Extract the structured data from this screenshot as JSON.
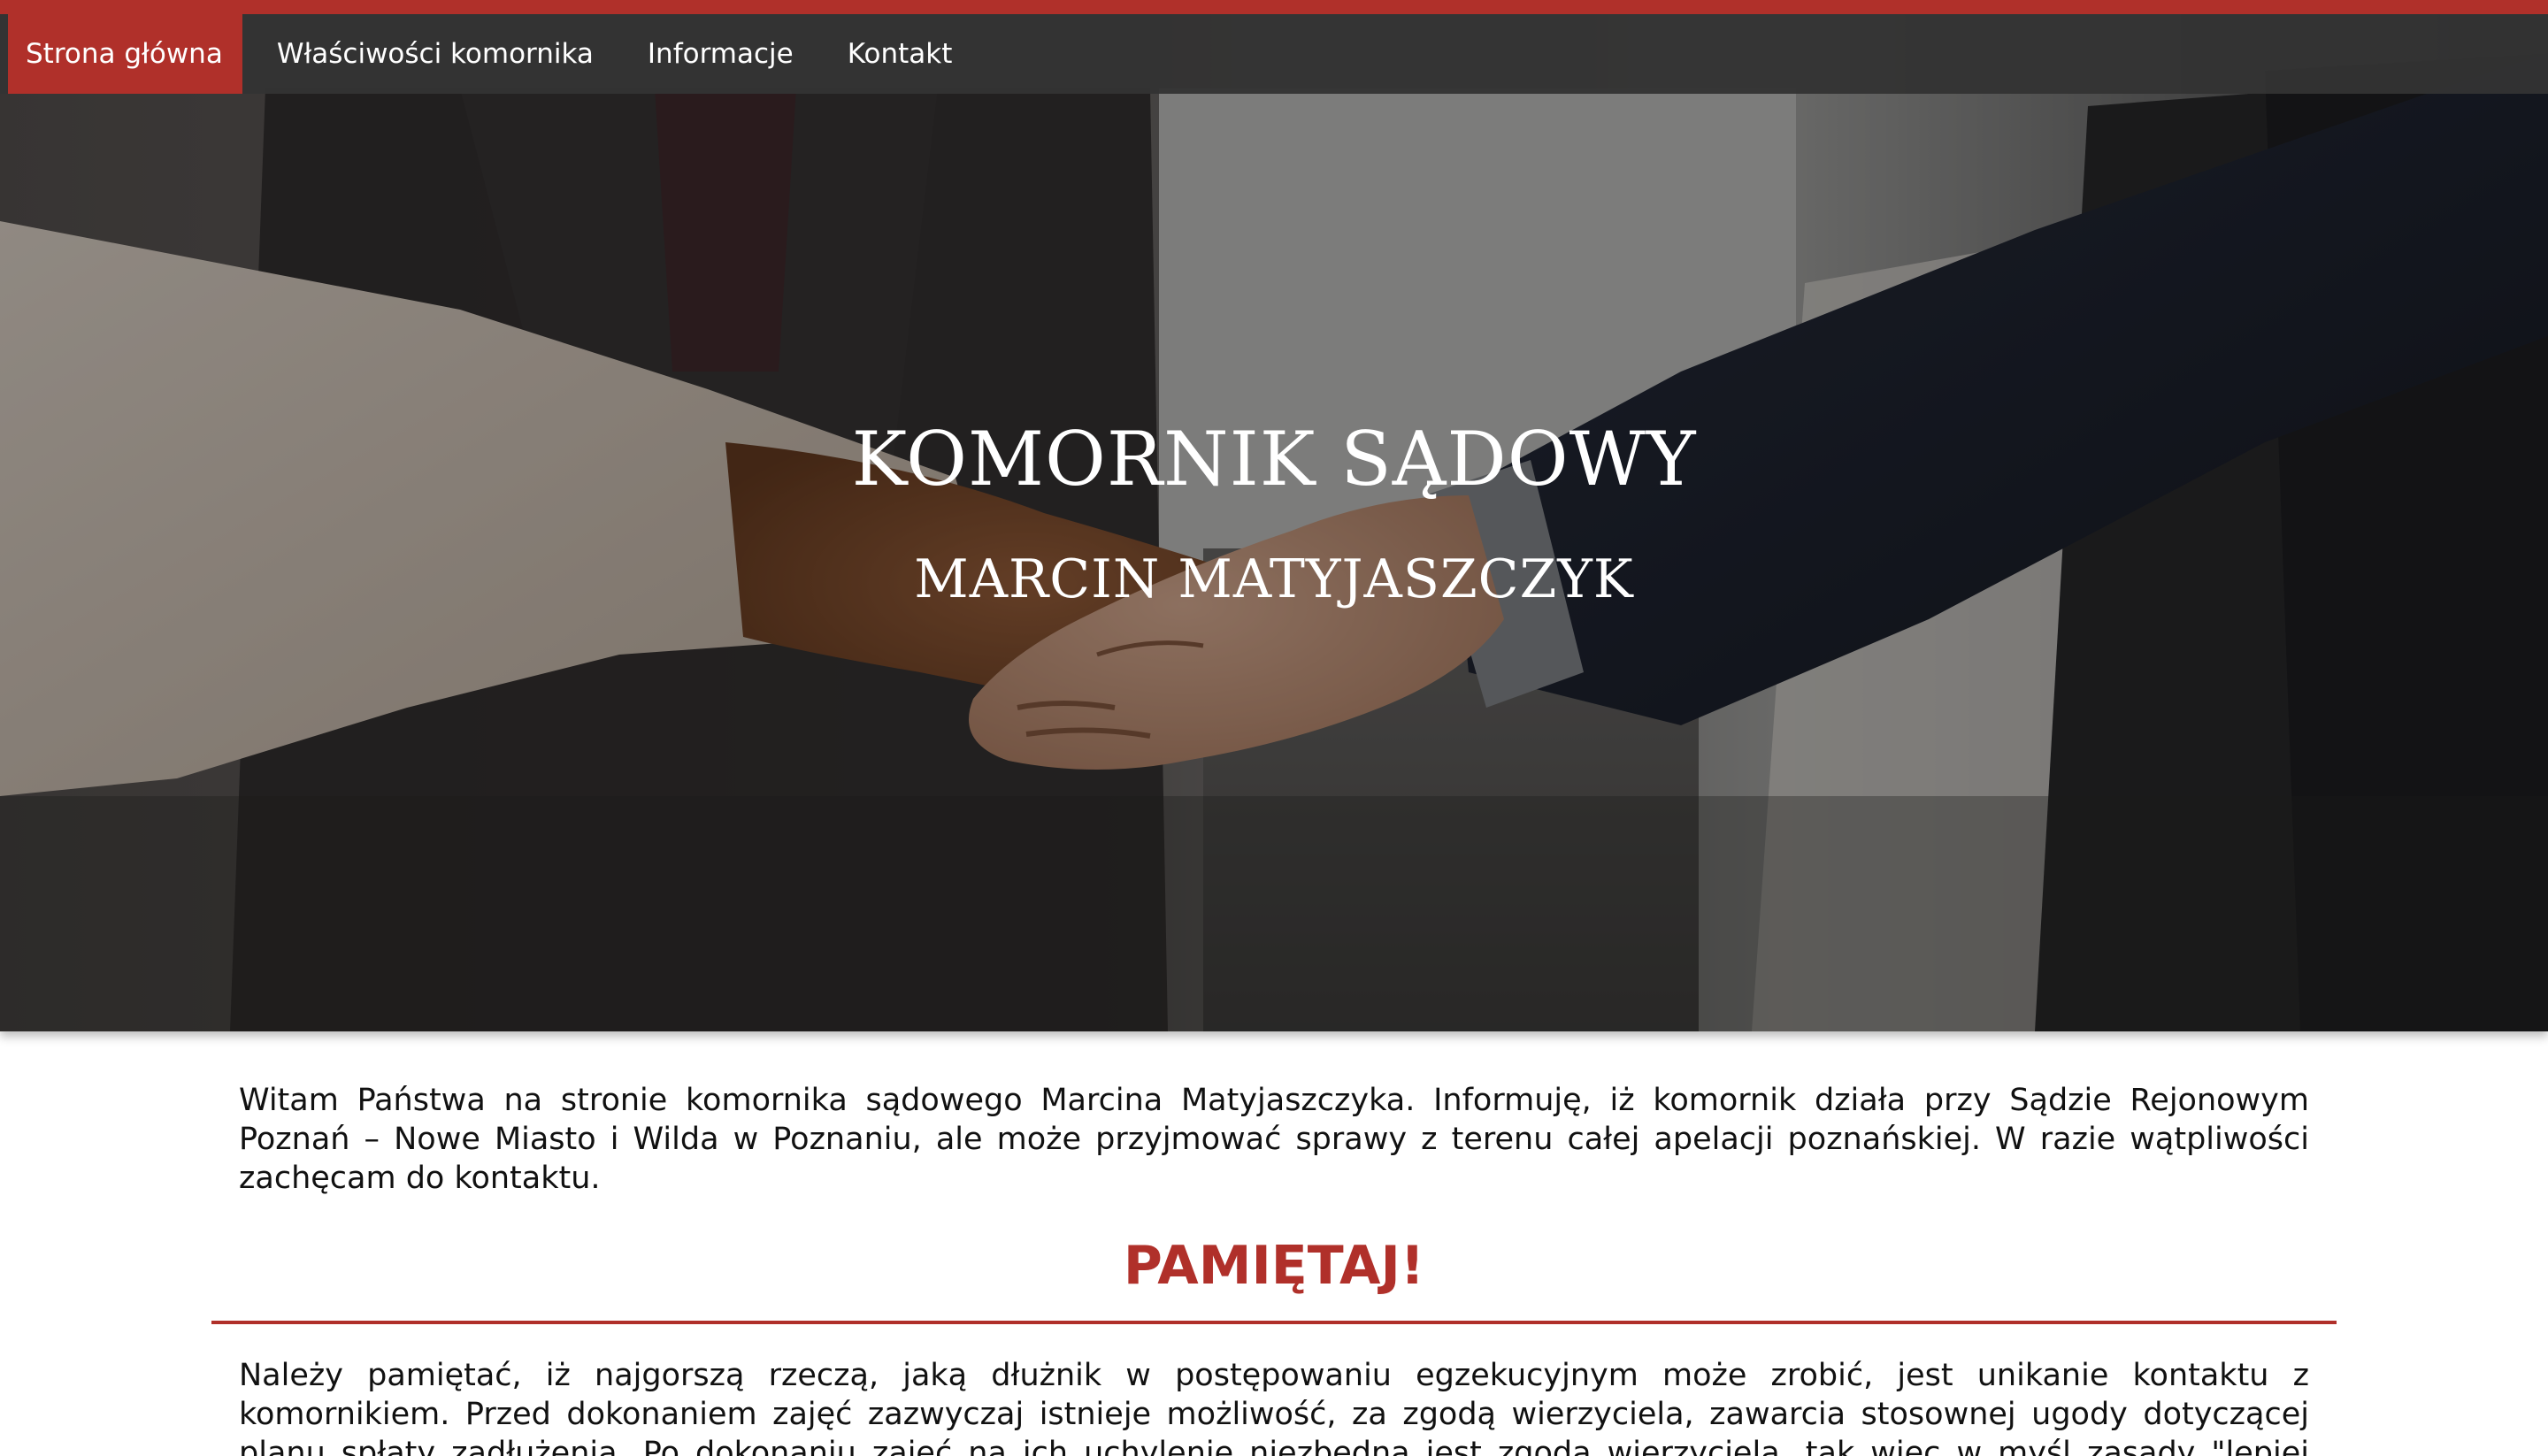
{
  "colors": {
    "accent": "#b0302a",
    "navbar_bg": "#333333",
    "text": "#111111",
    "hero_text": "#ffffff"
  },
  "nav": {
    "items": [
      {
        "label": "Strona główna",
        "active": true
      },
      {
        "label": "Właściwości komornika",
        "active": false
      },
      {
        "label": "Informacje",
        "active": false
      },
      {
        "label": "Kontakt",
        "active": false
      }
    ]
  },
  "hero": {
    "title": "KOMORNIK SĄDOWY",
    "subtitle": "MARCIN MATYJASZCZYK",
    "image": "handshake-photo"
  },
  "main": {
    "intro": "Witam Państwa na stronie komornika sądowego Marcina Matyjaszczyka. Informuję, iż komornik działa przy Sądzie Rejonowym Poznań – Nowe Miasto i Wilda w Poznaniu, ale może przyjmować sprawy z terenu całej apelacji poznańskiej. W razie wątpliwości zachęcam do kontaktu.",
    "section_heading": "PAMIĘTAJ!",
    "section_text": "Należy pamiętać, iż najgorszą rzeczą, jaką dłużnik w postępowaniu egzekucyjnym może zrobić, jest unikanie kontaktu z komornikiem. Przed dokonaniem zajęć zazwyczaj istnieje możliwość, za zgodą wierzyciela, zawarcia stosownej ugody dotyczącej planu spłaty zadłużenia. Po dokonaniu zajęć na ich uchylenie niezbędna jest zgoda wierzyciela, tak więc w myśl zasady \"lepiej zapobiegać niż gasić\" Państwa pierwsza"
  }
}
